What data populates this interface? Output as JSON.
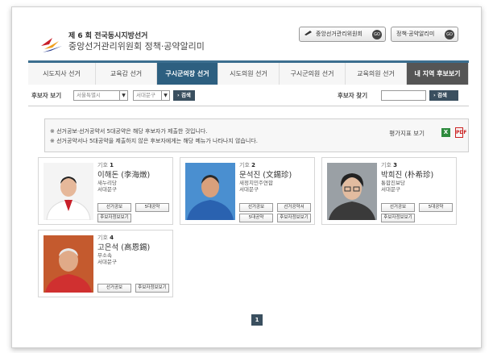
{
  "header": {
    "title_line1": "제 6 회 전국동시지방선거",
    "title_line2": "중앙선거관리위원회 정책·공약알리미",
    "btn_nec": "중앙선거관리위원회",
    "btn_policy": "정책·공약알리미",
    "go": "GO"
  },
  "tabs": [
    {
      "label": "시도지사 선거"
    },
    {
      "label": "교육감 선거"
    },
    {
      "label": "구시군의장 선거"
    },
    {
      "label": "시도의원 선거"
    },
    {
      "label": "구시군의원 선거"
    },
    {
      "label": "교육의원 선거"
    },
    {
      "label": "내 지역 후보보기"
    }
  ],
  "filter": {
    "label": "후보자 보기",
    "region": "서울특별시",
    "district": "서대문구",
    "search_btn": "› 검색",
    "find_label": "후보자 찾기",
    "find_btn": "› 검색",
    "find_value": ""
  },
  "notice": {
    "line1": "※ 선거공보·선거공약서 5대공약은 해당 후보자가 제출한 것입니다.",
    "line2": "※ 선거공약서나 5대공약을 제출하지 않은 후보자에게는 해당 메뉴가 나타나지 않습니다.",
    "eval": "평가지표 보기",
    "excel": "X",
    "pdf": "PDF"
  },
  "candidates": [
    {
      "num_label": "기호",
      "num": "1",
      "name": "이해돈 (李海燉)",
      "party": "새누리당",
      "district": "서대문구",
      "buttons": [
        "선거공보",
        "5대공약",
        "후보자정보보기"
      ]
    },
    {
      "num_label": "기호",
      "num": "2",
      "name": "문석진 (文錫珍)",
      "party": "새정치민주연합",
      "district": "서대문구",
      "buttons": [
        "선거공보",
        "선거공약서",
        "5대공약",
        "후보자정보보기"
      ]
    },
    {
      "num_label": "기호",
      "num": "3",
      "name": "박희진 (朴希珍)",
      "party": "통합진보당",
      "district": "서대문구",
      "buttons": [
        "선거공보",
        "5대공약",
        "후보자정보보기"
      ]
    },
    {
      "num_label": "기호",
      "num": "4",
      "name": "고은석 (高恩錫)",
      "party": "무소속",
      "district": "서대문구",
      "buttons": [
        "선거공보",
        "후보자정보보기"
      ]
    }
  ],
  "pagination": {
    "current": "1"
  },
  "colors": {
    "tab_active": "#2d5f80",
    "tab_dark": "#555555",
    "nav_border": "#3b6e8f",
    "button_dark": "#3a4f5f"
  }
}
